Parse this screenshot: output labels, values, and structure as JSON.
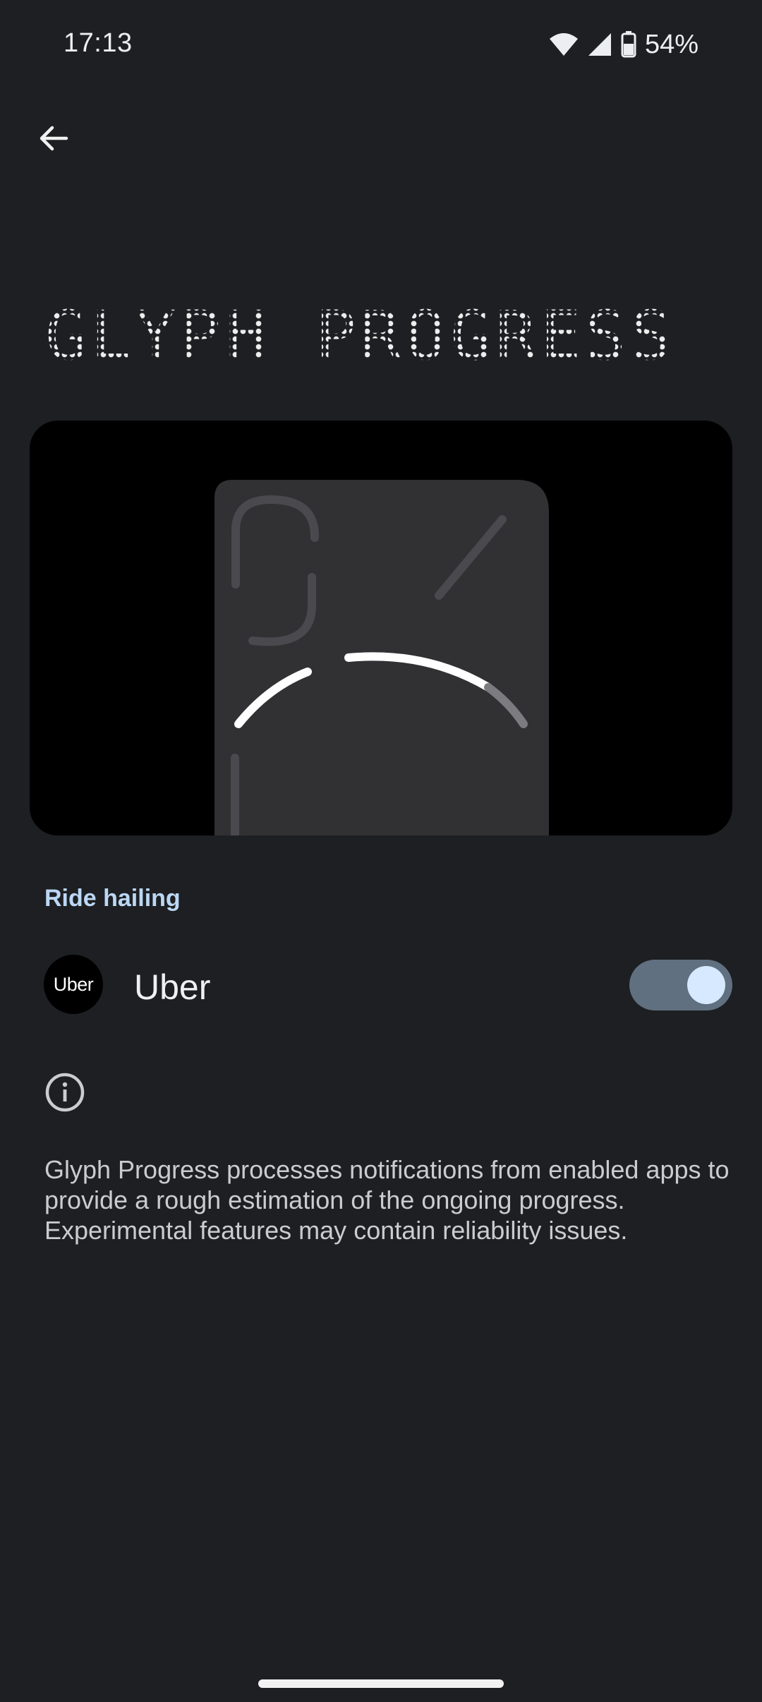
{
  "status_bar": {
    "time": "17:13",
    "battery": "54%",
    "icons": [
      "wifi-icon",
      "signal-icon",
      "battery-icon"
    ]
  },
  "nav": {
    "back_icon": "back-arrow-icon"
  },
  "page": {
    "title": "GLYPH PROGRESS"
  },
  "section": {
    "header": "Ride hailing"
  },
  "apps": [
    {
      "name": "Uber",
      "icon_text": "Uber",
      "enabled": true
    }
  ],
  "info": {
    "icon": "info-icon",
    "description": "Glyph Progress processes notifications from enabled apps to provide a rough estimation of the ongoing progress. Experimental features may contain reliability issues."
  },
  "colors": {
    "background": "#1d1f22",
    "accent": "#bcd7f4",
    "toggle_track": "#607080",
    "toggle_thumb": "#d6e9ff"
  }
}
